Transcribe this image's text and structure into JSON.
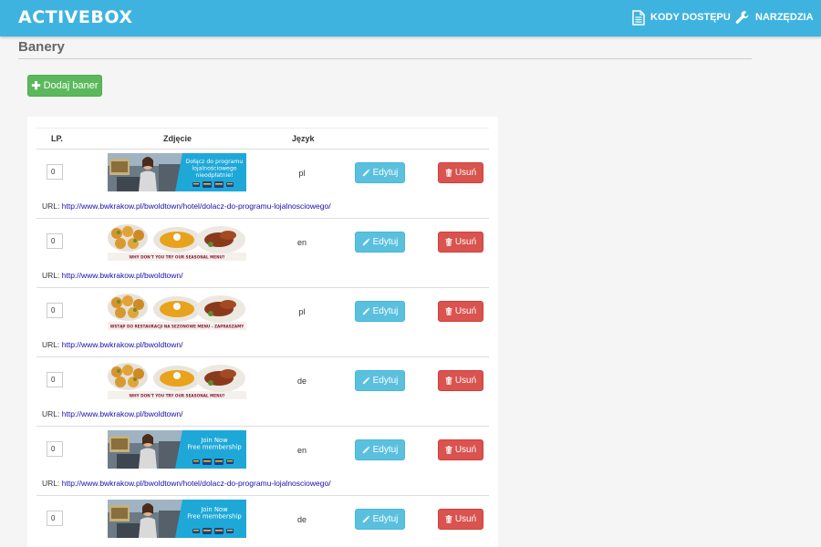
{
  "header": {
    "brand": "ACTIVEBOX",
    "nav_codes": "KODY DOSTĘPU",
    "nav_tools": "NARZĘDZIA"
  },
  "page": {
    "title": "Banery",
    "add_button": "Dodaj baner"
  },
  "table": {
    "headers": {
      "lp": "LP.",
      "image": "Zdjęcie",
      "language": "Język"
    },
    "edit_label": "Edytuj",
    "delete_label": "Usuń",
    "url_prefix": "URL:",
    "rows": [
      {
        "order": "0",
        "language": "pl",
        "url": "http://www.bwkrakow.pl/bwoldtown/hotel/dolacz-do-programu-lojalnosciowego/",
        "banner": {
          "kind": "loyalty",
          "lines": [
            "Dołącz do programu",
            "lojalnościowego",
            "nieodpłatnie!"
          ]
        }
      },
      {
        "order": "0",
        "language": "en",
        "url": "http://www.bwkrakow.pl/bwoldtown/",
        "banner": {
          "kind": "food",
          "caption": "WHY DON'T YOU TRY OUR SEASONAL MENU?"
        }
      },
      {
        "order": "0",
        "language": "pl",
        "url": "http://www.bwkrakow.pl/bwoldtown/",
        "banner": {
          "kind": "food",
          "caption": "WSTĄP DO RESTAURACJI NA SEZONOWE MENU - ZAPRASZAMY"
        }
      },
      {
        "order": "0",
        "language": "de",
        "url": "http://www.bwkrakow.pl/bwoldtown/",
        "banner": {
          "kind": "food",
          "caption": "WHY DON'T YOU TRY OUR SEASONAL MENU?"
        }
      },
      {
        "order": "0",
        "language": "en",
        "url": "http://www.bwkrakow.pl/bwoldtown/hotel/dolacz-do-programu-lojalnosciowego/",
        "banner": {
          "kind": "loyalty",
          "lines": [
            "Join Now",
            "Free membership"
          ]
        }
      },
      {
        "order": "0",
        "language": "de",
        "url": "",
        "banner": {
          "kind": "loyalty",
          "lines": [
            "Join Now",
            "Free membership"
          ]
        }
      }
    ]
  },
  "colors": {
    "topbar": "#3fb3e0",
    "add": "#5cb85c",
    "edit": "#5bc0de",
    "delete": "#d9534f",
    "link": "#1a0dab"
  },
  "icons": {
    "nav_codes": "document-icon",
    "nav_tools": "wrench-icon",
    "add": "plus-icon",
    "edit": "pencil-icon",
    "delete": "trash-icon"
  }
}
